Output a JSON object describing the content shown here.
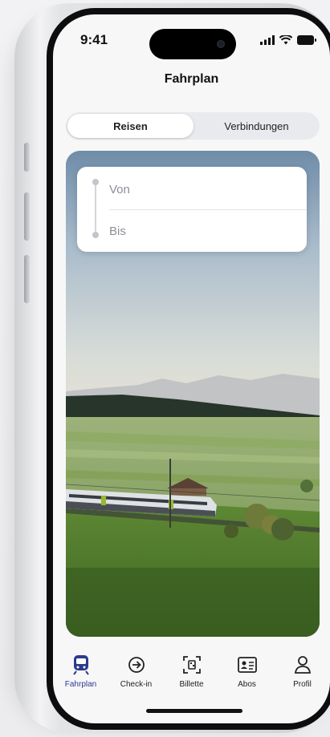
{
  "status_bar": {
    "time": "9:41"
  },
  "header": {
    "title": "Fahrplan"
  },
  "segmented": {
    "items": [
      {
        "label": "Reisen",
        "active": true
      },
      {
        "label": "Verbindungen",
        "active": false
      }
    ]
  },
  "route": {
    "from_placeholder": "Von",
    "to_placeholder": "Bis"
  },
  "tabbar": {
    "items": [
      {
        "label": "Fahrplan",
        "icon": "train-icon",
        "active": true
      },
      {
        "label": "Check-in",
        "icon": "check-in-arrow-icon",
        "active": false
      },
      {
        "label": "Billette",
        "icon": "ticket-qr-icon",
        "active": false
      },
      {
        "label": "Abos",
        "icon": "id-card-icon",
        "active": false
      },
      {
        "label": "Profil",
        "icon": "person-icon",
        "active": false
      }
    ]
  },
  "colors": {
    "accent": "#2d3a8c",
    "background": "#f7f7f8",
    "segmented_bg": "#e9eaee"
  }
}
